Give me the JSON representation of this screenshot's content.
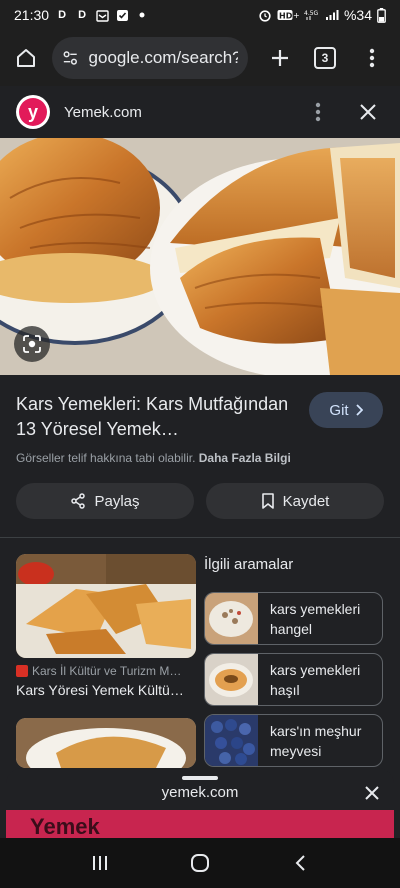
{
  "status": {
    "time": "21:30",
    "left_icons": [
      "D",
      "D"
    ],
    "battery": "%34"
  },
  "browser": {
    "url": "google.com/search?q",
    "tab_count": "3"
  },
  "source": {
    "name": "Yemek.com",
    "logo_letter": "y"
  },
  "result": {
    "title": "Kars Yemekleri: Kars Mutfağından 13 Yöresel Yemek…",
    "go_label": "Git",
    "copyright_text": "Görseller telif hakkına tabi olabilir.",
    "more_info": "Daha Fazla Bilgi",
    "share_label": "Paylaş",
    "save_label": "Kaydet"
  },
  "related_cards": [
    {
      "source": "Kars İl Kültür ve Turizm M…",
      "title": "Kars Yöresi Yemek Kültü…"
    }
  ],
  "related_searches": {
    "heading": "İlgili aramalar",
    "items": [
      {
        "line1": "kars yemekleri",
        "line2": "hangel"
      },
      {
        "line1": "kars yemekleri",
        "line2": "haşıl"
      },
      {
        "line1": "kars'ın meşhur",
        "line2": "meyvesi"
      }
    ]
  },
  "bottom_sheet": {
    "title": "yemek.com",
    "preview_text": "Yemek"
  },
  "colors": {
    "brand": "#e21a5a",
    "go_button": "#394457",
    "background": "#202124"
  }
}
